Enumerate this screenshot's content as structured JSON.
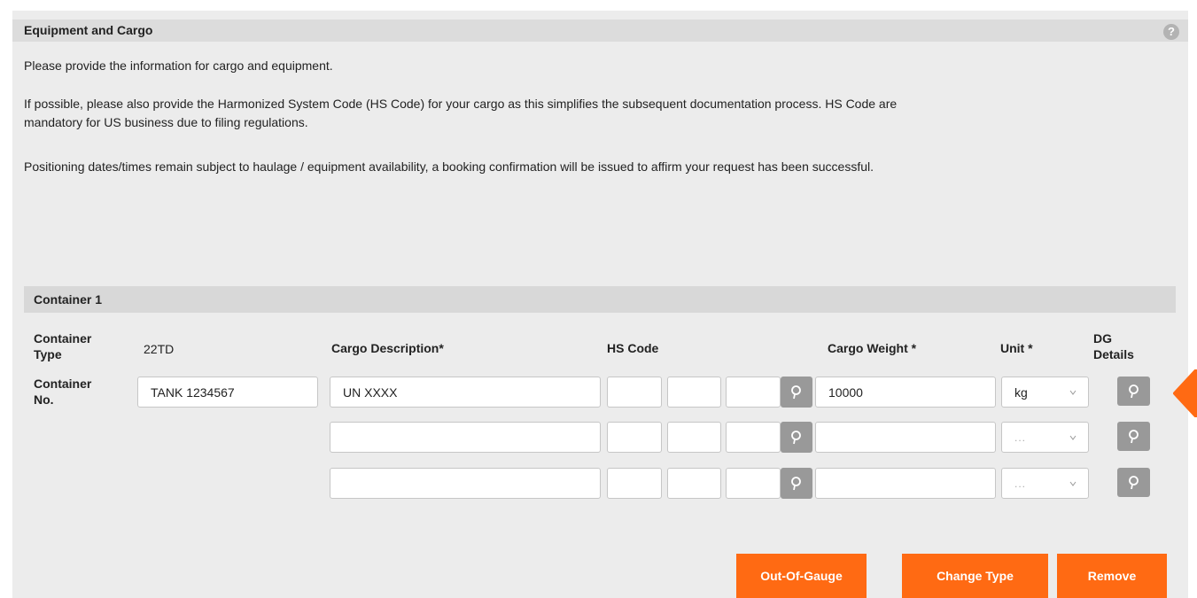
{
  "section": {
    "title": "Equipment and Cargo",
    "help_icon": "question-icon",
    "intro": "Please provide the information for cargo and equipment.",
    "hs_note_line1": "If possible, please also provide the Harmonized System Code (HS Code) for your cargo as this simplifies the subsequent documentation process. HS Code are",
    "hs_note_line2": "mandatory for US business due to filing regulations.",
    "positioning_note": "Positioning dates/times remain subject to haulage / equipment availability, a booking confirmation will be issued to affirm your request has been successful."
  },
  "container": {
    "title": "Container 1",
    "type_label_1": "Container",
    "type_label_2": "Type",
    "type_value": "22TD",
    "no_label_1": "Container",
    "no_label_2": "No.",
    "no_value": "TANK 1234567",
    "columns": {
      "cargo_description": "Cargo Description*",
      "hs_code": "HS Code",
      "cargo_weight": "Cargo Weight *",
      "unit": "Unit *",
      "dg_details_1": "DG",
      "dg_details_2": "Details"
    },
    "rows": [
      {
        "description": "UN XXXX",
        "hs1": "",
        "hs2": "",
        "hs3": "",
        "weight": "10000",
        "unit": "kg"
      },
      {
        "description": "",
        "hs1": "",
        "hs2": "",
        "hs3": "",
        "weight": "",
        "unit": "..."
      },
      {
        "description": "",
        "hs1": "",
        "hs2": "",
        "hs3": "",
        "weight": "",
        "unit": "..."
      }
    ]
  },
  "buttons": {
    "out_of_gauge": "Out-Of-Gauge",
    "change_type": "Change Type",
    "remove": "Remove"
  },
  "colors": {
    "accent": "#ff6a13",
    "panel_bg": "#ececec",
    "header_bg": "#dcdcdc",
    "icon_button": "#999999"
  },
  "icons": {
    "search": "search-icon",
    "dropdown": "chevron-down-icon",
    "side_tab": "caret-left-icon"
  }
}
